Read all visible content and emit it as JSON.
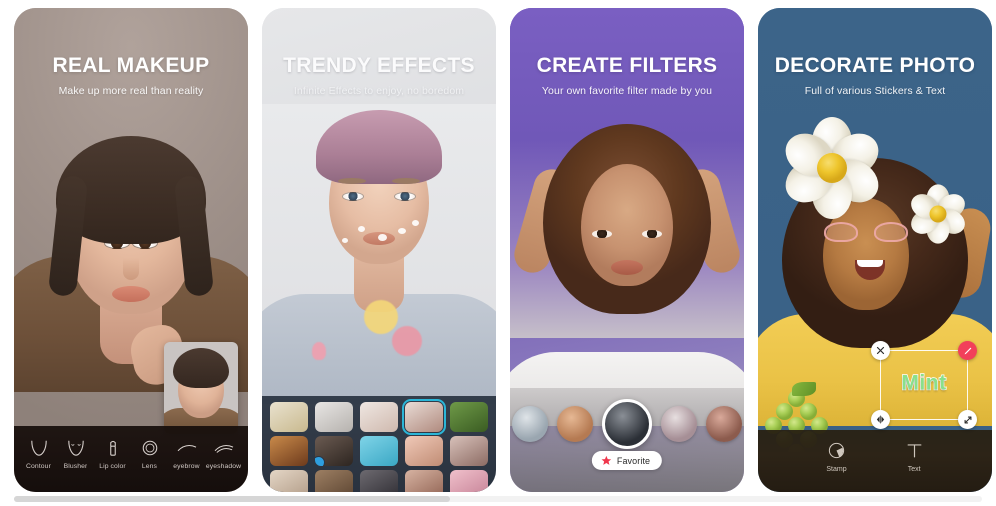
{
  "app": {
    "screenshot_count": 4
  },
  "panels": [
    {
      "id": "real-makeup",
      "title": "REAL MAKEUP",
      "subtitle": "Make up more real than reality",
      "bg_color": "#a4968f",
      "toolbar": {
        "items": [
          {
            "label": "Contour",
            "icon": "contour-icon"
          },
          {
            "label": "Blusher",
            "icon": "blusher-icon"
          },
          {
            "label": "Lip color",
            "icon": "lipstick-icon"
          },
          {
            "label": "Lens",
            "icon": "lens-icon"
          },
          {
            "label": "eyebrow",
            "icon": "eyebrow-icon"
          },
          {
            "label": "eyeshadow",
            "icon": "eyeshadow-icon"
          }
        ]
      }
    },
    {
      "id": "trendy-effects",
      "title": "TRENDY EFFECTS",
      "subtitle": "Infinite Effects to enjoy, no boredom",
      "bg_color": "#dcdde0",
      "grid": {
        "selected_index": 3,
        "rows": [
          [
            {
              "name": "flowers-effect",
              "color1": "#e9e2cf",
              "color2": "#c9b98e"
            },
            {
              "name": "mask-effect",
              "color1": "#e8e6e4",
              "color2": "#b6b2ae"
            },
            {
              "name": "portrait-effect",
              "color1": "#efe7e2",
              "color2": "#cfb9ae"
            },
            {
              "name": "selfie-effect",
              "color1": "#e9dcd6",
              "color2": "#b08a7e"
            },
            {
              "name": "frog-effect",
              "color1": "#6f9a48",
              "color2": "#3a5c22"
            }
          ],
          [
            {
              "name": "golden-effect",
              "color1": "#c98a4a",
              "color2": "#6d3a1c"
            },
            {
              "name": "beard-effect",
              "color1": "#6b5b52",
              "color2": "#2d2520"
            },
            {
              "name": "emoji-effect",
              "color1": "#7fd4e8",
              "color2": "#3aa7c4"
            },
            {
              "name": "smile-effect",
              "color1": "#f0c9b8",
              "color2": "#c08c74"
            },
            {
              "name": "anime-effect",
              "color1": "#d8c1ba",
              "color2": "#8c6b63"
            }
          ],
          [
            {
              "name": "cream-effect",
              "color1": "#e4d6c6",
              "color2": "#b09a85"
            },
            {
              "name": "brown-effect",
              "color1": "#9d7f63",
              "color2": "#5a4330"
            },
            {
              "name": "dark-effect",
              "color1": "#6d6a70",
              "color2": "#2e2c32"
            },
            {
              "name": "bunny-effect",
              "color1": "#d7b3a2",
              "color2": "#8f6151"
            },
            {
              "name": "pink-effect",
              "color1": "#f0c0cb",
              "color2": "#c47f94"
            }
          ]
        ]
      }
    },
    {
      "id": "create-filters",
      "title": "CREATE FILTERS",
      "subtitle": "Your own favorite filter made by you",
      "bg_color": "#6c4fb4",
      "filter_strip": {
        "active_index": 2,
        "thumbs": [
          {
            "name": "cat-filter",
            "color1": "#dfe4e8",
            "color2": "#9aa6b0"
          },
          {
            "name": "warm-filter",
            "color1": "#e6b894",
            "color2": "#b57a52"
          },
          {
            "name": "noir-filter",
            "color1": "#8a8f96",
            "color2": "#2b2f36"
          },
          {
            "name": "soft-filter",
            "color1": "#e7dfe0",
            "color2": "#a68f96"
          },
          {
            "name": "vivid-filter",
            "color1": "#d9a99a",
            "color2": "#8c5b4d"
          }
        ]
      },
      "favorite_button": {
        "label": "Favorite",
        "icon": "star-icon",
        "icon_color": "#f0374d"
      }
    },
    {
      "id": "decorate-photo",
      "title": "DECORATE PHOTO",
      "subtitle": "Full of various Stickers & Text",
      "bg_color": "#3a6287",
      "text_sticker": {
        "text": "Mint",
        "text_color": "#8ae08a",
        "outline_color": "#ffffff",
        "handles": [
          {
            "name": "delete-handle",
            "icon": "close-icon",
            "position": "tl"
          },
          {
            "name": "edit-handle",
            "icon": "pencil-icon",
            "position": "tr",
            "color": "#f2405a"
          },
          {
            "name": "flip-handle",
            "icon": "flip-icon",
            "position": "bl"
          },
          {
            "name": "resize-handle",
            "icon": "resize-icon",
            "position": "br"
          }
        ]
      },
      "toolbar": {
        "items": [
          {
            "label": "Stamp",
            "icon": "stamp-icon"
          },
          {
            "label": "Text",
            "icon": "text-icon"
          }
        ]
      }
    }
  ],
  "scrollbar": {
    "orientation": "horizontal",
    "thumb_fraction": 0.45
  }
}
